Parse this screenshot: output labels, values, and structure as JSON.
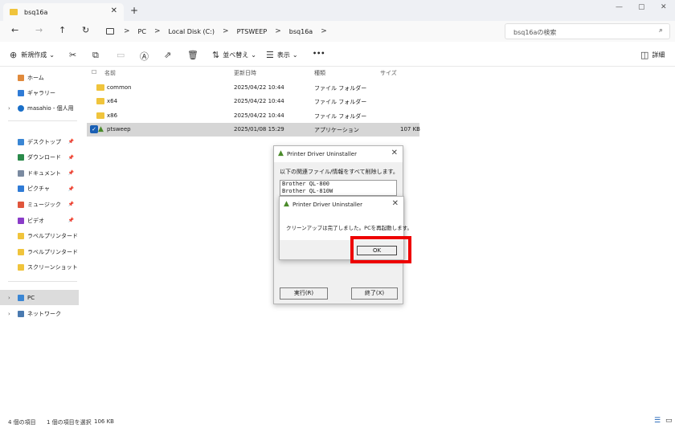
{
  "window": {
    "tab_title": "bsq16a",
    "tab_close": "✕",
    "new_tab": "+",
    "minimize": "—",
    "maximize": "▢",
    "close": "✕"
  },
  "address": {
    "back": "←",
    "forward": "→",
    "up": "↑",
    "refresh": "↻",
    "breadcrumb": [
      "PC",
      "Local Disk (C:)",
      "PTSWEEP",
      "bsq16a"
    ],
    "separator": ">",
    "search_placeholder": "bsq16aの検索",
    "search_icon": "⌕"
  },
  "toolbar": {
    "new_label": "新規作成",
    "sort_label": "並べ替え",
    "view_label": "表示",
    "more_label": "•••",
    "details_label": "詳細",
    "dropdown": "⌄"
  },
  "sidebar": {
    "home": "ホーム",
    "gallery": "ギャラリー",
    "onedrive": "masahio - 個人用",
    "quick": [
      {
        "label": "デスクトップ",
        "color": "#3a86d4"
      },
      {
        "label": "ダウンロード",
        "color": "#2a8a4a"
      },
      {
        "label": "ドキュメント",
        "color": "#7a8aa0"
      },
      {
        "label": "ピクチャ",
        "color": "#2f7bd6"
      },
      {
        "label": "ミュージック",
        "color": "#e0553c"
      },
      {
        "label": "ビデオ",
        "color": "#8a3cc8"
      },
      {
        "label": "ラベルプリンタードラ",
        "color": "#f0c43c"
      },
      {
        "label": "ラベルプリンタードライバ",
        "color": "#f0c43c"
      },
      {
        "label": "スクリーンショット",
        "color": "#f0c43c"
      }
    ],
    "pin": "📌",
    "pc": "PC",
    "network": "ネットワーク"
  },
  "columns": {
    "name": "名前",
    "date": "更新日時",
    "type": "種類",
    "size": "サイズ"
  },
  "files": [
    {
      "name": "common",
      "date": "2025/04/22 10:44",
      "type": "ファイル フォルダー",
      "size": "",
      "kind": "folder"
    },
    {
      "name": "x64",
      "date": "2025/04/22 10:44",
      "type": "ファイル フォルダー",
      "size": "",
      "kind": "folder"
    },
    {
      "name": "x86",
      "date": "2025/04/22 10:44",
      "type": "ファイル フォルダー",
      "size": "",
      "kind": "folder"
    },
    {
      "name": "ptsweep",
      "date": "2025/01/08 15:29",
      "type": "アプリケーション",
      "size": "107 KB",
      "kind": "app"
    }
  ],
  "dialog_main": {
    "title": "Printer Driver Uninstaller",
    "message": "以下の関連ファイル/情報をすべて削除します。",
    "list_items": [
      "Brother QL-800",
      "Brother QL-810W"
    ],
    "run_button": "実行(R)",
    "exit_button": "終了(X)"
  },
  "dialog_msg": {
    "title": "Printer Driver Uninstaller",
    "message": "クリーンアップは完了しました。PCを再起動します。",
    "ok_button": "OK"
  },
  "status": {
    "count": "4 個の項目",
    "selected": "1 個の項目を選択",
    "size": "106 KB"
  },
  "colors": {
    "highlight": "#ee0000",
    "selection": "#d6d6d6",
    "folder": "#f0c43c"
  }
}
